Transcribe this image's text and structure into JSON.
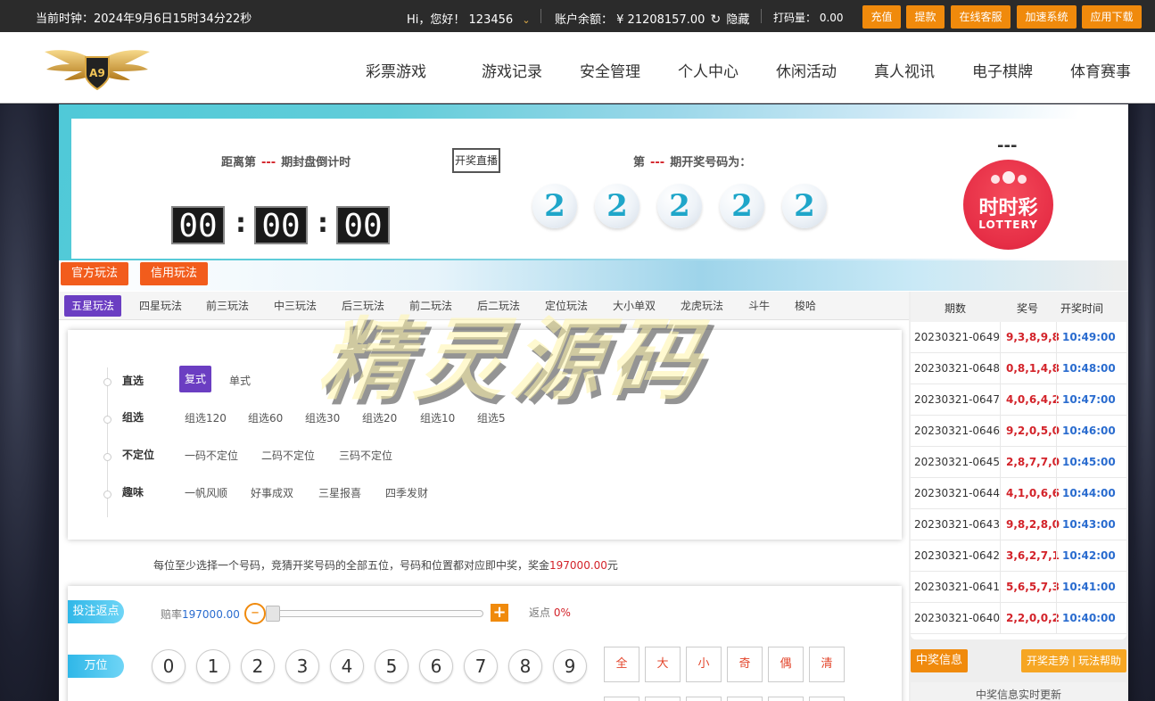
{
  "topbar": {
    "clock": "当前时钟：2024年9月6日15时34分22秒",
    "greeting": "Hi，您好！",
    "username": "123456",
    "balance_label": "账户余额：",
    "balance_value": "¥ 21208157.00",
    "hide_label": "隐藏",
    "turnover_label": "打码量：",
    "turnover_value": "0.00",
    "buttons": [
      "充值",
      "提款",
      "在线客服",
      "加速系统",
      "应用下载"
    ]
  },
  "logo": {
    "text": "A9"
  },
  "nav": [
    "彩票游戏",
    "游戏记录",
    "安全管理",
    "个人中心",
    "休闲活动",
    "真人视讯",
    "电子棋牌",
    "体育赛事"
  ],
  "hero": {
    "countdown_prefix": "距离第",
    "countdown_period": "---",
    "countdown_suffix": "期封盘倒计时",
    "live_button": "开奖直播",
    "time": [
      "00",
      "00",
      "00"
    ],
    "draw_prefix": "第",
    "draw_period": "---",
    "draw_suffix": "期开奖号码为：",
    "balls": [
      "2",
      "2",
      "2",
      "2",
      "2"
    ],
    "lottery_dash": "---",
    "lottery_logo_cn": "时时彩",
    "lottery_logo_en": "LOTTERY"
  },
  "modes": [
    "官方玩法",
    "信用玩法"
  ],
  "tabs": [
    "五星玩法",
    "四星玩法",
    "前三玩法",
    "中三玩法",
    "后三玩法",
    "前二玩法",
    "后二玩法",
    "定位玩法",
    "大小单双",
    "龙虎玩法",
    "斗牛",
    "梭哈"
  ],
  "play_groups": [
    {
      "label": "直选",
      "options": [
        "复式",
        "单式"
      ]
    },
    {
      "label": "组选",
      "options": [
        "组选120",
        "组选60",
        "组选30",
        "组选20",
        "组选10",
        "组选5"
      ]
    },
    {
      "label": "不定位",
      "options": [
        "一码不定位",
        "二码不定位",
        "三码不定位"
      ]
    },
    {
      "label": "趣味",
      "options": [
        "一帆风顺",
        "好事成双",
        "三星报喜",
        "四季发财"
      ]
    }
  ],
  "description": {
    "text": "每位至少选择一个号码，竞猜开奖号码的全部五位，号码和位置都对应即中奖，奖金",
    "amount": "197000.00",
    "unit": "元"
  },
  "bet": {
    "rebate_pill": "投注返点",
    "odds_label": "赔率",
    "odds_value": "197000.00",
    "rebate_label": "返点",
    "rebate_value": "0%",
    "position_label": "万位",
    "numbers": [
      "0",
      "1",
      "2",
      "3",
      "4",
      "5",
      "6",
      "7",
      "8",
      "9"
    ],
    "quick": [
      "全",
      "大",
      "小",
      "奇",
      "偶",
      "清"
    ]
  },
  "history": {
    "headers": [
      "期数",
      "奖号",
      "开奖时间"
    ],
    "rows": [
      {
        "period": "20230321-0649",
        "code": "9,3,8,9,8",
        "time": "10:49:00"
      },
      {
        "period": "20230321-0648",
        "code": "0,8,1,4,8",
        "time": "10:48:00"
      },
      {
        "period": "20230321-0647",
        "code": "4,0,6,4,2",
        "time": "10:47:00"
      },
      {
        "period": "20230321-0646",
        "code": "9,2,0,5,0",
        "time": "10:46:00"
      },
      {
        "period": "20230321-0645",
        "code": "2,8,7,7,0",
        "time": "10:45:00"
      },
      {
        "period": "20230321-0644",
        "code": "4,1,0,6,6",
        "time": "10:44:00"
      },
      {
        "period": "20230321-0643",
        "code": "9,8,2,8,0",
        "time": "10:43:00"
      },
      {
        "period": "20230321-0642",
        "code": "3,6,2,7,1",
        "time": "10:42:00"
      },
      {
        "period": "20230321-0641",
        "code": "5,6,5,7,3",
        "time": "10:41:00"
      },
      {
        "period": "20230321-0640",
        "code": "2,2,0,0,2",
        "time": "10:40:00"
      }
    ],
    "win_info_tab": "中奖信息",
    "trend_link": "开奖走势",
    "help_link": "玩法帮助",
    "live_update": "中奖信息实时更新"
  },
  "watermark": "精灵源码"
}
